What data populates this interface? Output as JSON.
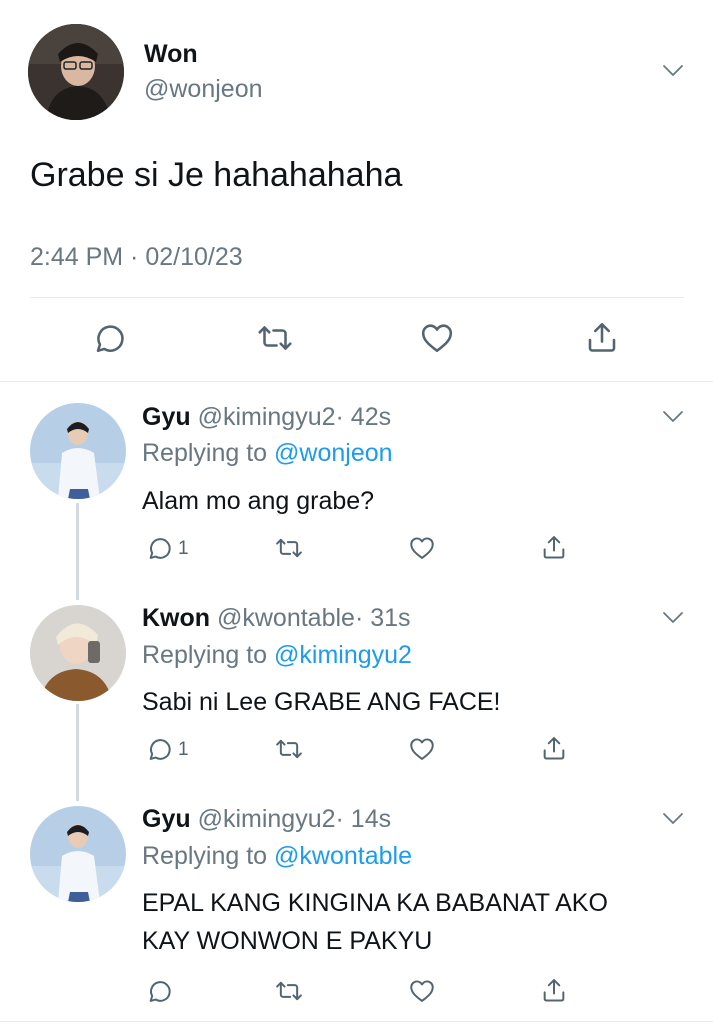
{
  "main_tweet": {
    "name": "Won",
    "handle": "@wonjeon",
    "text": "Grabe si Je hahahahaha",
    "timestamp": "2:44 PM · 02/10/23"
  },
  "replies": [
    {
      "name": "Gyu",
      "handle": "@kimingyu2",
      "time": "· 42s",
      "replying_prefix": "Replying to ",
      "replying_to": "@wonjeon",
      "text": "Alam mo ang grabe?",
      "reply_count": "1"
    },
    {
      "name": "Kwon",
      "handle": "@kwontable",
      "time": "· 31s",
      "replying_prefix": "Replying to ",
      "replying_to": "@kimingyu2",
      "text": "Sabi ni Lee GRABE ANG FACE!",
      "reply_count": "1"
    },
    {
      "name": "Gyu",
      "handle": "@kimingyu2",
      "time": "· 14s",
      "replying_prefix": "Replying to ",
      "replying_to": "@kwontable",
      "text_line1": "EPAL KANG KINGINA KA BABANAT AKO",
      "text_line2": "KAY WONWON E PAKYU",
      "reply_count": ""
    }
  ],
  "colors": {
    "link": "#1d9bf0",
    "secondary_text": "#687782",
    "icon": "#536471",
    "divider": "#e6ecf0"
  },
  "icons": [
    "reply-icon",
    "retweet-icon",
    "like-icon",
    "share-icon",
    "chevron-down-icon"
  ]
}
